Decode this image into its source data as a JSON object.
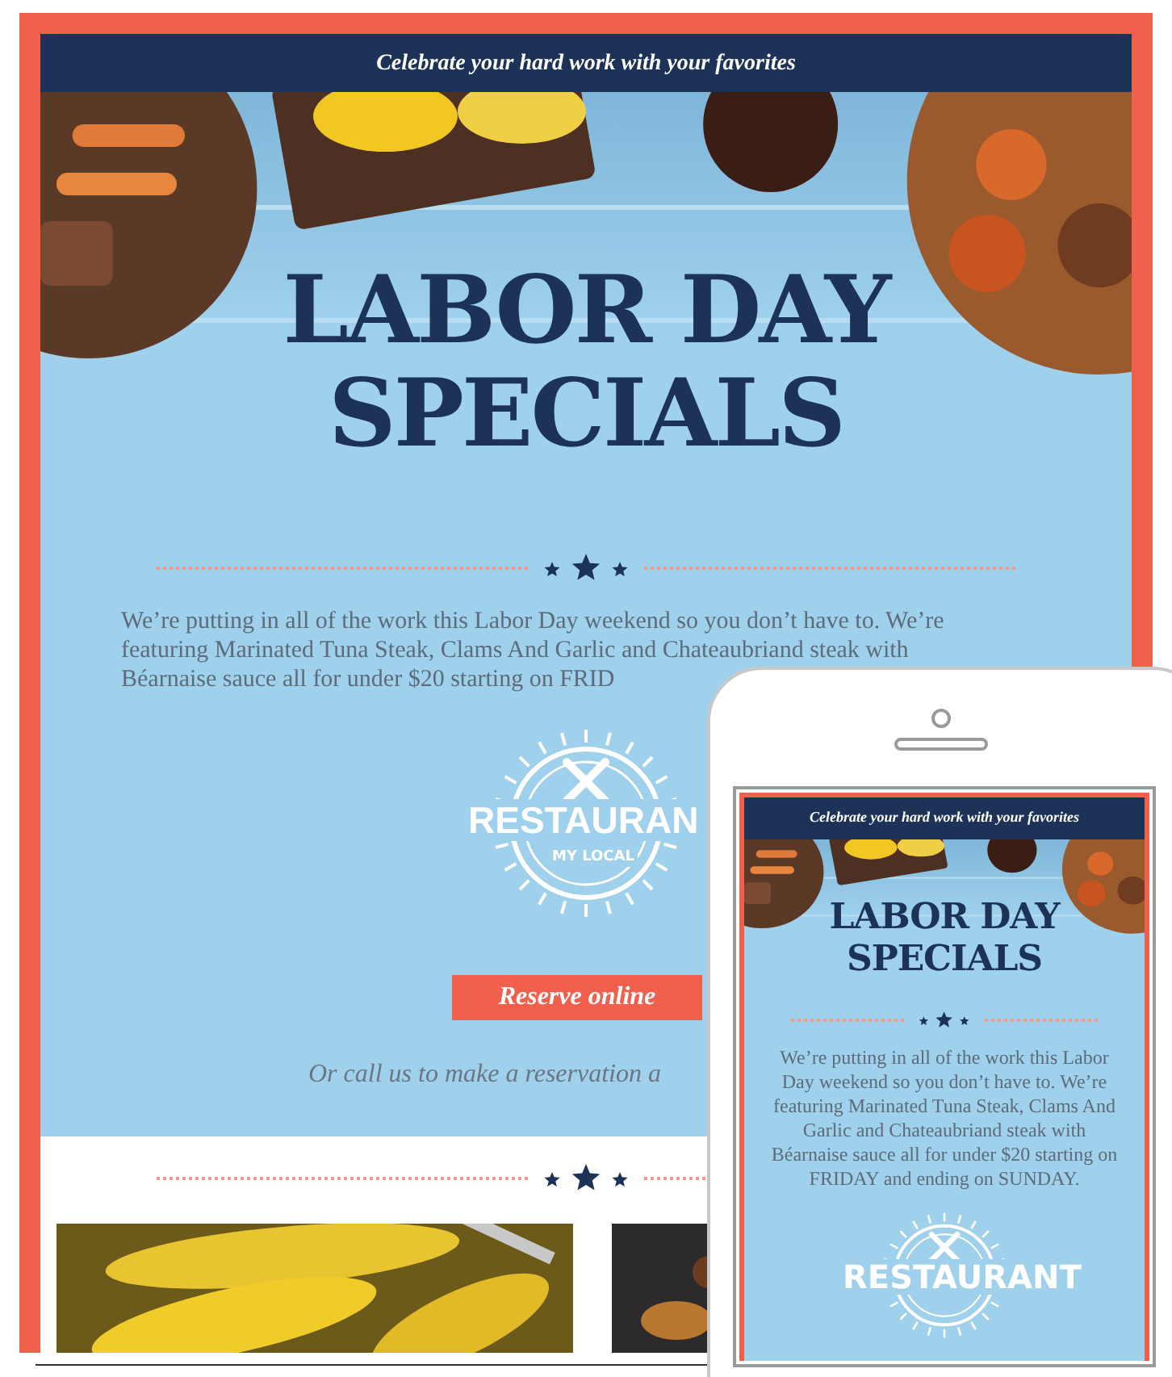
{
  "desktop": {
    "banner": "Celebrate your hard work with your favorites",
    "title_lines": [
      "LABOR DAY",
      "SPECIALS"
    ],
    "intro": "We’re putting in all of the work this Labor Day weekend so you don’t have to. We’re\nfeaturing Marinated Tuna Steak, Clams And Garlic and Chateaubriand steak with\nBéarnaise sauce all for under $20 starting on FRID",
    "logo": {
      "name": "RESTAURAN",
      "tagline": "MY LOCAL"
    },
    "reserve_button": "Reserve online",
    "call_text": "Or call us to make a reservation a"
  },
  "phone": {
    "banner": "Celebrate your hard work with your favorites",
    "title_lines": [
      "LABOR DAY",
      "SPECIALS"
    ],
    "intro": "We’re putting in all of the work this Labor Day weekend so you don’t have to. We’re featuring Marinated Tuna Steak, Clams And Garlic and Chateaubriand steak with Béarnaise sauce all for under $20 starting on FRIDAY and ending on SUNDAY.",
    "logo": {
      "name": "RESTAURANT"
    }
  }
}
